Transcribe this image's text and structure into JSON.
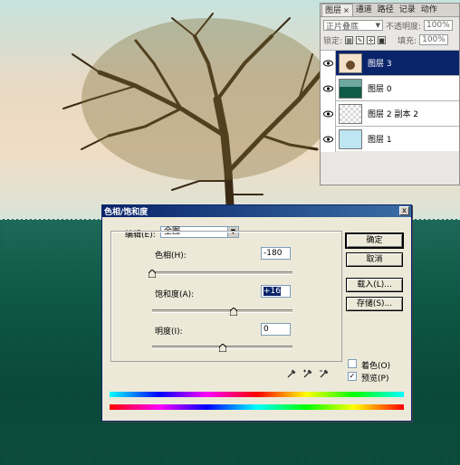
{
  "layers_panel": {
    "tabs": [
      {
        "label": "图层",
        "active": true,
        "close": "×"
      },
      {
        "label": "通道"
      },
      {
        "label": "路径"
      },
      {
        "label": "记录"
      },
      {
        "label": "动作"
      }
    ],
    "blend_mode": "正片叠底",
    "opacity_label": "不透明度:",
    "opacity_value": "100%",
    "lock_label": "锁定:",
    "fill_label": "填充:",
    "fill_value": "100%",
    "layers": [
      {
        "name": "图层 3",
        "selected": true
      },
      {
        "name": "图层 0",
        "selected": false
      },
      {
        "name": "图层 2 副本 2",
        "selected": false
      },
      {
        "name": "图层 1",
        "selected": false
      }
    ]
  },
  "dialog": {
    "title": "色相/饱和度",
    "close": "x",
    "edit_label": "编辑(E):",
    "edit_value": "全图",
    "hue_label": "色相(H):",
    "hue_value": "-180",
    "hue_level": 0.0,
    "saturation_label": "饱和度(A):",
    "saturation_value": "+16",
    "saturation_level": 0.58,
    "lightness_label": "明度(I):",
    "lightness_value": "0",
    "lightness_level": 0.5,
    "buttons": {
      "ok": "确定",
      "cancel": "取消",
      "load": "载入(L)...",
      "save": "存储(S)..."
    },
    "colorize_label": "着色(O)",
    "colorize_checked": false,
    "preview_label": "预览(P)",
    "preview_checked": true,
    "check_mark": "✓"
  }
}
